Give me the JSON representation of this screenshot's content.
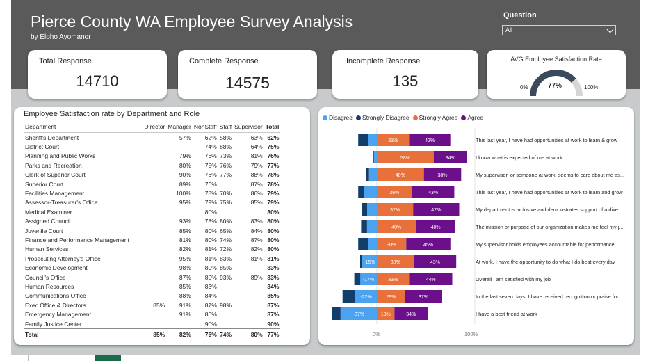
{
  "header": {
    "title": "Pierce County WA Employee Survey Analysis",
    "subtitle": "by Eloho Ayomanor"
  },
  "slicer": {
    "label": "Question",
    "value": "All"
  },
  "cards": {
    "total": {
      "label": "Total Response",
      "value": "14710"
    },
    "complete": {
      "label": "Complete Response",
      "value": "14575"
    },
    "incomplete": {
      "label": "Incomplete Response",
      "value": "135"
    },
    "satisfaction": {
      "label": "AVG Employee Satisfaction Rate",
      "value": "77%",
      "min": "0%",
      "max": "100%",
      "fraction": 0.77
    }
  },
  "table": {
    "title": "Employee Satisfaction rate by Department and Role",
    "columns": [
      "Department",
      "Director",
      "Manager",
      "NonStaff",
      "Staff",
      "Supervisor",
      "Total"
    ],
    "rows": [
      [
        "Sheriff's Department",
        "",
        "57%",
        "62%",
        "58%",
        "63%",
        "62%"
      ],
      [
        "District Court",
        "",
        "",
        "74%",
        "88%",
        "64%",
        "75%"
      ],
      [
        "Planning and Public Works",
        "",
        "79%",
        "76%",
        "73%",
        "81%",
        "76%"
      ],
      [
        "Parks and Recreation",
        "",
        "80%",
        "75%",
        "76%",
        "79%",
        "77%"
      ],
      [
        "Clerk of Superior Court",
        "",
        "90%",
        "76%",
        "77%",
        "88%",
        "78%"
      ],
      [
        "Superior Court",
        "",
        "89%",
        "76%",
        "",
        "87%",
        "78%"
      ],
      [
        "Facilities Management",
        "",
        "100%",
        "78%",
        "70%",
        "86%",
        "79%"
      ],
      [
        "Assessor-Treasurer's Office",
        "",
        "95%",
        "79%",
        "75%",
        "85%",
        "79%"
      ],
      [
        "Medical Examiner",
        "",
        "",
        "80%",
        "",
        "",
        "80%"
      ],
      [
        "Assigned Council",
        "",
        "93%",
        "78%",
        "80%",
        "83%",
        "80%"
      ],
      [
        "Juvenile Court",
        "",
        "85%",
        "80%",
        "65%",
        "84%",
        "80%"
      ],
      [
        "Finance and Performance Management",
        "",
        "81%",
        "80%",
        "74%",
        "87%",
        "80%"
      ],
      [
        "Human Services",
        "",
        "82%",
        "81%",
        "72%",
        "82%",
        "80%"
      ],
      [
        "Prosecuting Attorney's Office",
        "",
        "95%",
        "81%",
        "83%",
        "81%",
        "81%"
      ],
      [
        "Economic Development",
        "",
        "98%",
        "80%",
        "85%",
        "",
        "83%"
      ],
      [
        "Council's Office",
        "",
        "87%",
        "80%",
        "93%",
        "89%",
        "83%"
      ],
      [
        "Human Resources",
        "",
        "85%",
        "83%",
        "",
        "",
        "84%"
      ],
      [
        "Communications Office",
        "",
        "88%",
        "84%",
        "",
        "",
        "85%"
      ],
      [
        "Exec Office & Directors",
        "85%",
        "91%",
        "87%",
        "98%",
        "",
        "87%"
      ],
      [
        "Emergency Management",
        "",
        "91%",
        "86%",
        "",
        "",
        "87%"
      ],
      [
        "Family Justice Center",
        "",
        "",
        "90%",
        "",
        "",
        "90%"
      ]
    ],
    "total_row": [
      "Total",
      "85%",
      "82%",
      "76%",
      "74%",
      "80%",
      "77%"
    ]
  },
  "chart_data": {
    "type": "bar",
    "orientation": "horizontal-diverging-stacked",
    "legend_position": "top-left",
    "xaxis_ticks": [
      "0%",
      "100%"
    ],
    "xlim": [
      -0.5,
      1.0
    ],
    "colors": {
      "Disagree": "#4ba3f0",
      "Strongly Disagree": "#123e6b",
      "Strongly Agree": "#e8703a",
      "Agree": "#6b0f8a"
    },
    "categories": [
      "This last year, I have had opportunities at work to learn & grow",
      "I know what is expected of me at work",
      "My supervisor, or someone at work, seems to care about me as...",
      "This last year, I have had opportunities at work to learn and grow",
      "My department is inclusive and demonstrates support of a dive...",
      "The mission or purpose of our organization makes me feel my j...",
      "My supervisor holds employees accountable for performance",
      "At work, I have the opportunity to do what I do best every day",
      "Overall I am satisfied with my job",
      "In the last seven days, I have received recognition or praise for ...",
      "I have a best friend at work"
    ],
    "series": [
      {
        "name": "Disagree",
        "values": [
          -0.09,
          -0.03,
          -0.08,
          -0.13,
          -0.1,
          -0.1,
          -0.09,
          -0.15,
          -0.17,
          -0.22,
          -0.37
        ],
        "labels": [
          "",
          "",
          "",
          "",
          "",
          "",
          "",
          "-15%",
          "-17%",
          "-22%",
          "-37%"
        ]
      },
      {
        "name": "Strongly Disagree",
        "values": [
          -0.1,
          -0.01,
          -0.03,
          -0.06,
          -0.05,
          -0.06,
          -0.1,
          -0.02,
          -0.06,
          -0.13,
          -0.09
        ],
        "labels": [
          "",
          "",
          "",
          "",
          "",
          "",
          "",
          "",
          "",
          "",
          ""
        ]
      },
      {
        "name": "Strongly Agree",
        "values": [
          0.33,
          0.58,
          0.48,
          0.36,
          0.37,
          0.4,
          0.3,
          0.38,
          0.33,
          0.29,
          0.18
        ],
        "labels": [
          "33%",
          "58%",
          "48%",
          "36%",
          "37%",
          "40%",
          "30%",
          "38%",
          "33%",
          "29%",
          "18%"
        ]
      },
      {
        "name": "Agree",
        "values": [
          0.42,
          0.34,
          0.38,
          0.43,
          0.47,
          0.4,
          0.45,
          0.43,
          0.44,
          0.37,
          0.34
        ],
        "labels": [
          "42%",
          "34%",
          "38%",
          "43%",
          "47%",
          "40%",
          "45%",
          "43%",
          "44%",
          "37%",
          "34%"
        ]
      }
    ]
  }
}
